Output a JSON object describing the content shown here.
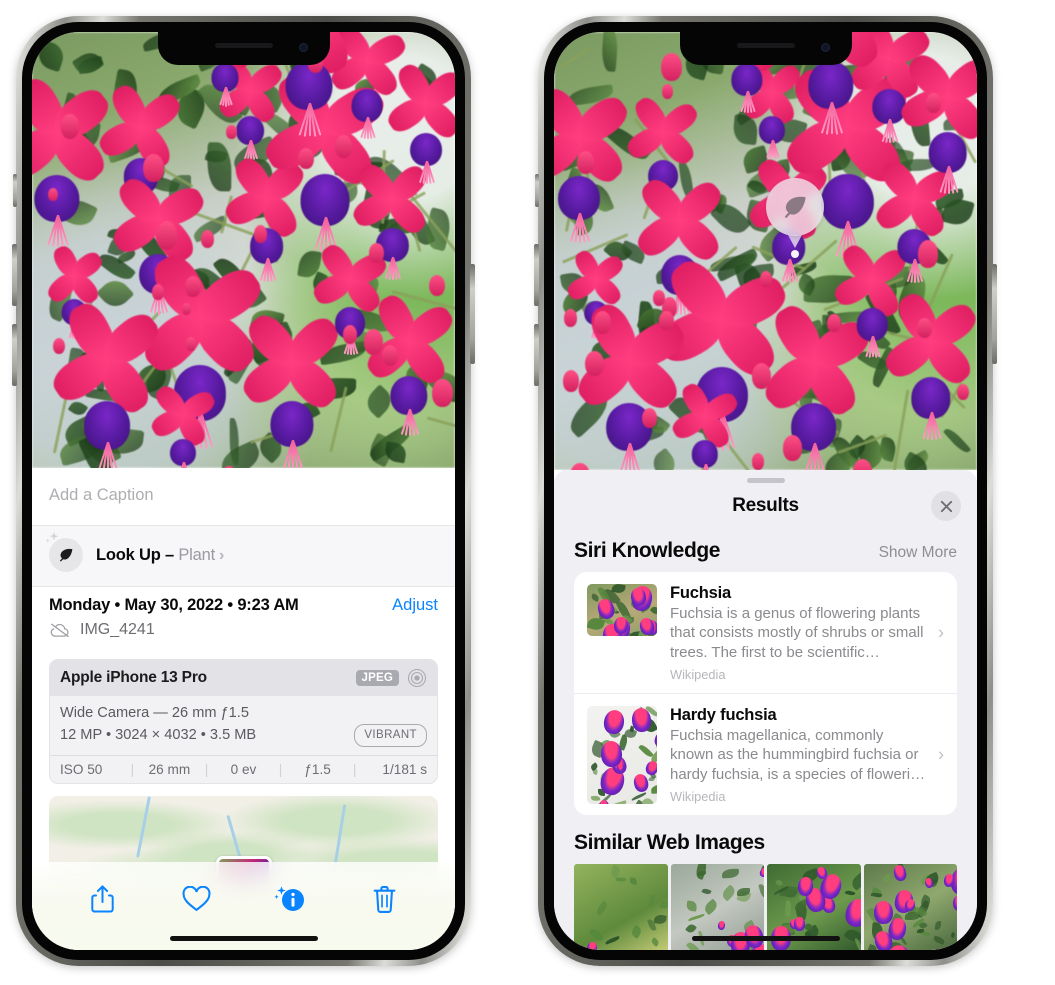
{
  "left_phone": {
    "photo": {
      "alt": "fuchsia-plant-photo"
    },
    "caption_input": {
      "placeholder": "Add a Caption",
      "value": ""
    },
    "lookup_row": {
      "icon": "leaf-icon",
      "sparkle_icon": "sparkles-icon",
      "label": "Look Up –",
      "subject": "Plant",
      "chevron": "chevron-right-icon"
    },
    "metadata": {
      "date": "Monday • May 30, 2022 • 9:23 AM",
      "adjust_label": "Adjust",
      "cloud_icon": "cloud-slash-icon",
      "filename": "IMG_4241"
    },
    "exif": {
      "device": "Apple iPhone 13 Pro",
      "format_badge": "JPEG",
      "hdr_icon": "hdr-ring-icon",
      "lens_line": "Wide Camera — 26 mm ƒ1.5",
      "size_line": "12 MP • 3024 × 4032 • 3.5 MB",
      "style_badge": "VIBRANT",
      "stats": [
        "ISO 50",
        "26 mm",
        "0 ev",
        "ƒ1.5",
        "1/181 s"
      ]
    },
    "map": {
      "alt": "location-map-thumbnail"
    },
    "toolbar": [
      {
        "name": "share-button",
        "icon": "share-icon"
      },
      {
        "name": "favorite-button",
        "icon": "heart-icon"
      },
      {
        "name": "info-button",
        "icon": "info-sparkle-icon"
      },
      {
        "name": "delete-button",
        "icon": "trash-icon"
      }
    ],
    "accent_color": "#0a84ff"
  },
  "right_phone": {
    "photo": {
      "alt": "fuchsia-plant-photo"
    },
    "lookup_pin": {
      "icon": "leaf-icon"
    },
    "sheet": {
      "title": "Results",
      "close_icon": "close-icon",
      "sections": [
        {
          "title": "Siri Knowledge",
          "action": "Show More",
          "items": [
            {
              "name": "Fuchsia",
              "description": "Fuchsia is a genus of flowering plants that consists mostly of shrubs or small trees. The first to be scientific…",
              "source": "Wikipedia",
              "chevron": "chevron-right-icon"
            },
            {
              "name": "Hardy fuchsia",
              "description": "Fuchsia magellanica, commonly known as the hummingbird fuchsia or hardy fuchsia, is a species of floweri…",
              "source": "Wikipedia",
              "chevron": "chevron-right-icon"
            }
          ]
        },
        {
          "title": "Similar Web Images",
          "thumbnails": [
            "similar-image-1",
            "similar-image-2",
            "similar-image-3",
            "similar-image-4"
          ]
        }
      ]
    },
    "sheet_bg": "#f0eff4"
  }
}
